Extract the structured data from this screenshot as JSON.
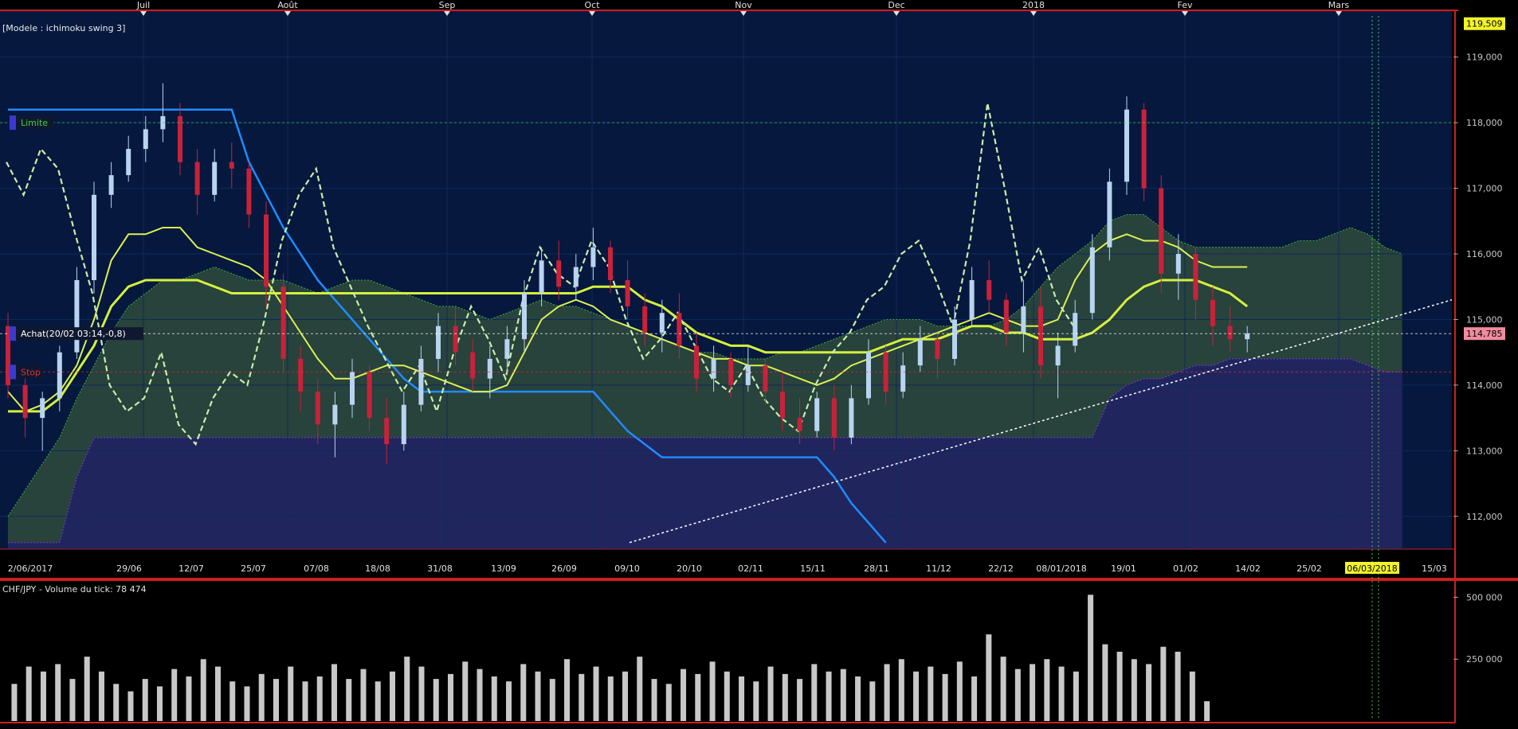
{
  "chart_data": {
    "type": "candlestick",
    "instrument": "CHF/JPY",
    "model_label": "[Modele : ichimoku swing 3]",
    "top_month_labels": [
      "Juil",
      "Août",
      "Sep",
      "Oct",
      "Nov",
      "Dec",
      "2018",
      "Fev",
      "Mars"
    ],
    "x_date_labels": [
      "2/06/2017",
      "29/06",
      "12/07",
      "25/07",
      "07/08",
      "18/08",
      "31/08",
      "13/09",
      "26/09",
      "09/10",
      "20/10",
      "02/11",
      "15/11",
      "28/11",
      "11/12",
      "22/12",
      "08/01/2018",
      "19/01",
      "01/02",
      "14/02",
      "25/02",
      "06/03/2018",
      "15/03"
    ],
    "highlighted_date": "06/03/2018",
    "y_ticks": [
      "119,000",
      "118,000",
      "117,000",
      "116,000",
      "115,000",
      "114,000",
      "113,000",
      "112,000"
    ],
    "ylim": [
      111.5,
      119.7
    ],
    "price_badges": [
      {
        "text": "119,509",
        "value": 119.509,
        "color": "#f2f22a"
      },
      {
        "text": "114,785",
        "value": 114.785,
        "color": "#f08c9c"
      }
    ],
    "order_levels": [
      {
        "label": "Limite",
        "value": 118.0,
        "color": "#3cd23c"
      },
      {
        "label": "Achat(20/02 03:14,-0,8)",
        "value": 114.785,
        "color": "#ffffff"
      },
      {
        "label": "Stop",
        "value": 114.2,
        "color": "#e03030"
      }
    ],
    "series": [
      {
        "role": "candles",
        "values": [
          [
            114.9,
            115.1,
            113.8,
            114.0
          ],
          [
            114.0,
            114.1,
            113.2,
            113.5
          ],
          [
            113.5,
            113.9,
            113.0,
            113.8
          ],
          [
            113.8,
            114.6,
            113.6,
            114.5
          ],
          [
            114.5,
            115.8,
            114.4,
            115.6
          ],
          [
            115.6,
            117.1,
            115.4,
            116.9
          ],
          [
            116.9,
            117.4,
            116.7,
            117.2
          ],
          [
            117.2,
            117.8,
            117.1,
            117.6
          ],
          [
            117.6,
            118.1,
            117.4,
            117.9
          ],
          [
            117.9,
            118.6,
            117.7,
            118.1
          ],
          [
            118.1,
            118.3,
            117.2,
            117.4
          ],
          [
            117.4,
            117.6,
            116.6,
            116.9
          ],
          [
            116.9,
            117.6,
            116.8,
            117.4
          ],
          [
            117.4,
            117.7,
            117.0,
            117.3
          ],
          [
            117.3,
            117.4,
            116.4,
            116.6
          ],
          [
            116.6,
            116.8,
            115.2,
            115.5
          ],
          [
            115.5,
            115.7,
            114.2,
            114.4
          ],
          [
            114.4,
            114.6,
            113.6,
            113.9
          ],
          [
            113.9,
            114.1,
            113.1,
            113.4
          ],
          [
            113.4,
            113.9,
            112.9,
            113.7
          ],
          [
            113.7,
            114.4,
            113.5,
            114.2
          ],
          [
            114.2,
            114.3,
            113.3,
            113.5
          ],
          [
            113.5,
            113.8,
            112.8,
            113.1
          ],
          [
            113.1,
            113.9,
            113.0,
            113.7
          ],
          [
            113.7,
            114.6,
            113.6,
            114.4
          ],
          [
            114.4,
            115.1,
            114.2,
            114.9
          ],
          [
            114.9,
            115.2,
            114.3,
            114.5
          ],
          [
            114.5,
            114.7,
            113.9,
            114.1
          ],
          [
            114.1,
            114.6,
            113.8,
            114.4
          ],
          [
            114.4,
            114.9,
            114.2,
            114.7
          ],
          [
            114.7,
            115.6,
            114.5,
            115.4
          ],
          [
            115.4,
            116.1,
            115.2,
            115.9
          ],
          [
            115.9,
            116.2,
            115.3,
            115.5
          ],
          [
            115.5,
            116.0,
            115.3,
            115.8
          ],
          [
            115.8,
            116.4,
            115.6,
            116.1
          ],
          [
            116.1,
            116.2,
            115.4,
            115.6
          ],
          [
            115.6,
            115.9,
            115.0,
            115.2
          ],
          [
            115.2,
            115.4,
            114.6,
            114.8
          ],
          [
            114.8,
            115.3,
            114.5,
            115.1
          ],
          [
            115.1,
            115.4,
            114.4,
            114.6
          ],
          [
            114.6,
            114.8,
            113.9,
            114.1
          ],
          [
            114.1,
            114.6,
            113.9,
            114.4
          ],
          [
            114.4,
            114.5,
            113.8,
            114.0
          ],
          [
            114.0,
            114.6,
            113.9,
            114.3
          ],
          [
            114.3,
            114.4,
            113.7,
            113.9
          ],
          [
            113.9,
            114.2,
            113.3,
            113.5
          ],
          [
            113.5,
            113.8,
            113.1,
            113.3
          ],
          [
            113.3,
            113.9,
            113.2,
            113.8
          ],
          [
            113.8,
            114.0,
            113.0,
            113.2
          ],
          [
            113.2,
            114.0,
            113.1,
            113.8
          ],
          [
            113.8,
            114.7,
            113.7,
            114.5
          ],
          [
            114.5,
            114.6,
            113.7,
            113.9
          ],
          [
            113.9,
            114.5,
            113.8,
            114.3
          ],
          [
            114.3,
            114.9,
            114.2,
            114.7
          ],
          [
            114.7,
            114.8,
            114.1,
            114.4
          ],
          [
            114.4,
            115.2,
            114.3,
            115.0
          ],
          [
            115.0,
            115.8,
            114.9,
            115.6
          ],
          [
            115.6,
            115.9,
            115.1,
            115.3
          ],
          [
            115.3,
            115.4,
            114.6,
            114.8
          ],
          [
            114.8,
            115.6,
            114.5,
            115.2
          ],
          [
            115.2,
            115.5,
            114.1,
            114.3
          ],
          [
            114.3,
            114.8,
            113.8,
            114.6
          ],
          [
            114.6,
            115.3,
            114.5,
            115.1
          ],
          [
            115.1,
            116.3,
            115.0,
            116.1
          ],
          [
            116.1,
            117.3,
            115.9,
            117.1
          ],
          [
            117.1,
            118.4,
            116.9,
            118.2
          ],
          [
            118.2,
            118.3,
            116.8,
            117.0
          ],
          [
            117.0,
            117.2,
            115.4,
            115.7
          ],
          [
            115.7,
            116.3,
            115.3,
            116.0
          ],
          [
            116.0,
            116.1,
            115.0,
            115.3
          ],
          [
            115.3,
            115.5,
            114.6,
            114.9
          ],
          [
            114.9,
            115.2,
            114.5,
            114.7
          ],
          [
            114.7,
            114.9,
            114.5,
            114.785
          ]
        ]
      },
      {
        "role": "tenkan",
        "color": "#dcf052",
        "values": [
          113.9,
          113.6,
          113.7,
          113.9,
          114.3,
          115.0,
          115.9,
          116.3,
          116.3,
          116.4,
          116.4,
          116.1,
          116.0,
          115.9,
          115.8,
          115.6,
          115.2,
          114.8,
          114.4,
          114.1,
          114.1,
          114.2,
          114.3,
          114.3,
          114.2,
          114.1,
          114.0,
          113.9,
          113.9,
          114.0,
          114.5,
          115.0,
          115.2,
          115.3,
          115.2,
          115.0,
          114.9,
          114.8,
          114.7,
          114.6,
          114.5,
          114.4,
          114.4,
          114.3,
          114.3,
          114.2,
          114.1,
          114.0,
          114.1,
          114.3,
          114.4,
          114.5,
          114.6,
          114.7,
          114.8,
          114.9,
          115.0,
          115.1,
          115.0,
          114.9,
          114.9,
          115.0,
          115.6,
          116.0,
          116.2,
          116.3,
          116.2,
          116.2,
          116.1,
          115.9,
          115.8,
          115.8,
          115.8
        ]
      },
      {
        "role": "kijun",
        "color": "#d4f03c",
        "values": [
          113.6,
          113.6,
          113.6,
          113.8,
          114.2,
          114.6,
          115.2,
          115.5,
          115.6,
          115.6,
          115.6,
          115.6,
          115.5,
          115.4,
          115.4,
          115.4,
          115.4,
          115.4,
          115.4,
          115.4,
          115.4,
          115.4,
          115.4,
          115.4,
          115.4,
          115.4,
          115.4,
          115.4,
          115.4,
          115.4,
          115.4,
          115.4,
          115.4,
          115.4,
          115.5,
          115.5,
          115.5,
          115.3,
          115.2,
          115.0,
          114.8,
          114.7,
          114.6,
          114.6,
          114.5,
          114.5,
          114.5,
          114.5,
          114.5,
          114.5,
          114.5,
          114.6,
          114.7,
          114.7,
          114.7,
          114.8,
          114.9,
          114.9,
          114.8,
          114.8,
          114.7,
          114.7,
          114.7,
          114.8,
          115.0,
          115.3,
          115.5,
          115.6,
          115.6,
          115.6,
          115.5,
          115.4,
          115.2
        ]
      },
      {
        "role": "chikou",
        "color": "#c8eeaa",
        "values": [
          117.4,
          116.9,
          117.6,
          117.3,
          116.3,
          115.4,
          114.0,
          113.6,
          113.8,
          114.5,
          113.4,
          113.1,
          113.8,
          114.2,
          114.0,
          115.0,
          116.2,
          116.9,
          117.3,
          116.1,
          115.5,
          114.9,
          114.4,
          113.9,
          114.3,
          113.6,
          114.5,
          115.2,
          114.7,
          114.1,
          115.3,
          116.1,
          115.7,
          115.5,
          116.2,
          115.8,
          115.0,
          114.4,
          114.7,
          115.1,
          114.6,
          114.1,
          113.9,
          114.3,
          113.8,
          113.5,
          113.3,
          114.0,
          114.5,
          114.8,
          115.3,
          115.5,
          116.0,
          116.2,
          115.6,
          114.9,
          116.2,
          118.3,
          117.0,
          115.6,
          116.1,
          115.3,
          114.9
        ]
      },
      {
        "role": "senkou_a",
        "color": "#3cb43c",
        "values": [
          112.0,
          112.4,
          112.8,
          113.2,
          113.8,
          114.3,
          114.8,
          115.2,
          115.4,
          115.6,
          115.6,
          115.7,
          115.8,
          115.7,
          115.6,
          115.6,
          115.6,
          115.5,
          115.4,
          115.5,
          115.6,
          115.6,
          115.5,
          115.4,
          115.3,
          115.2,
          115.2,
          115.1,
          115.0,
          115.1,
          115.2,
          115.3,
          115.2,
          115.2,
          115.1,
          115.0,
          114.9,
          114.8,
          114.7,
          114.6,
          114.5,
          114.5,
          114.4,
          114.4,
          114.4,
          114.5,
          114.5,
          114.6,
          114.7,
          114.8,
          114.9,
          115.0,
          115.0,
          115.0,
          114.9,
          114.9,
          114.9,
          114.9,
          115.0,
          115.2,
          115.5,
          115.8,
          116.0,
          116.2,
          116.5,
          116.6,
          116.6,
          116.4,
          116.2,
          116.1,
          116.1,
          116.1,
          116.1,
          116.1,
          116.1,
          116.2,
          116.2,
          116.3,
          116.4,
          116.3,
          116.1,
          116.0
        ]
      },
      {
        "role": "senkou_b",
        "color": "#7840c8",
        "values": [
          111.6,
          111.6,
          111.6,
          111.6,
          112.6,
          113.2,
          113.2,
          113.2,
          113.2,
          113.2,
          113.2,
          113.2,
          113.2,
          113.2,
          113.2,
          113.2,
          113.2,
          113.2,
          113.2,
          113.2,
          113.2,
          113.2,
          113.2,
          113.2,
          113.2,
          113.2,
          113.2,
          113.2,
          113.2,
          113.2,
          113.2,
          113.2,
          113.2,
          113.2,
          113.2,
          113.2,
          113.2,
          113.2,
          113.2,
          113.2,
          113.2,
          113.2,
          113.2,
          113.2,
          113.2,
          113.2,
          113.2,
          113.2,
          113.2,
          113.2,
          113.2,
          113.2,
          113.2,
          113.2,
          113.2,
          113.2,
          113.2,
          113.2,
          113.2,
          113.2,
          113.2,
          113.2,
          113.2,
          113.2,
          113.8,
          114.0,
          114.1,
          114.1,
          114.2,
          114.3,
          114.3,
          114.4,
          114.4,
          114.4,
          114.4,
          114.4,
          114.4,
          114.4,
          114.4,
          114.3,
          114.2,
          114.2
        ]
      },
      {
        "role": "trend_blue",
        "color": "#1e8cff",
        "values": [
          118.2,
          118.2,
          118.2,
          118.2,
          118.2,
          118.2,
          118.2,
          118.2,
          118.2,
          118.2,
          118.2,
          118.2,
          118.2,
          118.2,
          117.4,
          116.9,
          116.4,
          116.0,
          115.6,
          115.3,
          115.0,
          114.7,
          114.4,
          114.1,
          113.9,
          113.9,
          113.9,
          113.9,
          113.9,
          113.9,
          113.9,
          113.9,
          113.9,
          113.9,
          113.9,
          113.6,
          113.3,
          113.1,
          112.9,
          112.9,
          112.9,
          112.9,
          112.9,
          112.9,
          112.9,
          112.9,
          112.9,
          112.9,
          112.6,
          112.2,
          111.9,
          111.6
        ]
      }
    ],
    "volume": {
      "label": "CHF/JPY - Volume du tick: 78 474",
      "y_ticks": [
        "500 000",
        "250 000"
      ],
      "ylim": [
        0,
        540000
      ],
      "values": [
        150000,
        220000,
        200000,
        230000,
        170000,
        260000,
        200000,
        150000,
        120000,
        170000,
        140000,
        210000,
        180000,
        250000,
        220000,
        160000,
        140000,
        190000,
        170000,
        220000,
        160000,
        180000,
        230000,
        170000,
        210000,
        160000,
        200000,
        260000,
        220000,
        170000,
        190000,
        240000,
        210000,
        180000,
        160000,
        230000,
        200000,
        170000,
        250000,
        190000,
        220000,
        180000,
        200000,
        260000,
        170000,
        150000,
        210000,
        190000,
        240000,
        200000,
        180000,
        160000,
        220000,
        190000,
        170000,
        230000,
        200000,
        210000,
        180000,
        160000,
        230000,
        250000,
        200000,
        220000,
        190000,
        240000,
        180000,
        350000,
        260000,
        210000,
        230000,
        250000,
        220000,
        200000,
        510000,
        310000,
        280000,
        250000,
        230000,
        300000,
        280000,
        200000,
        80000
      ]
    }
  }
}
